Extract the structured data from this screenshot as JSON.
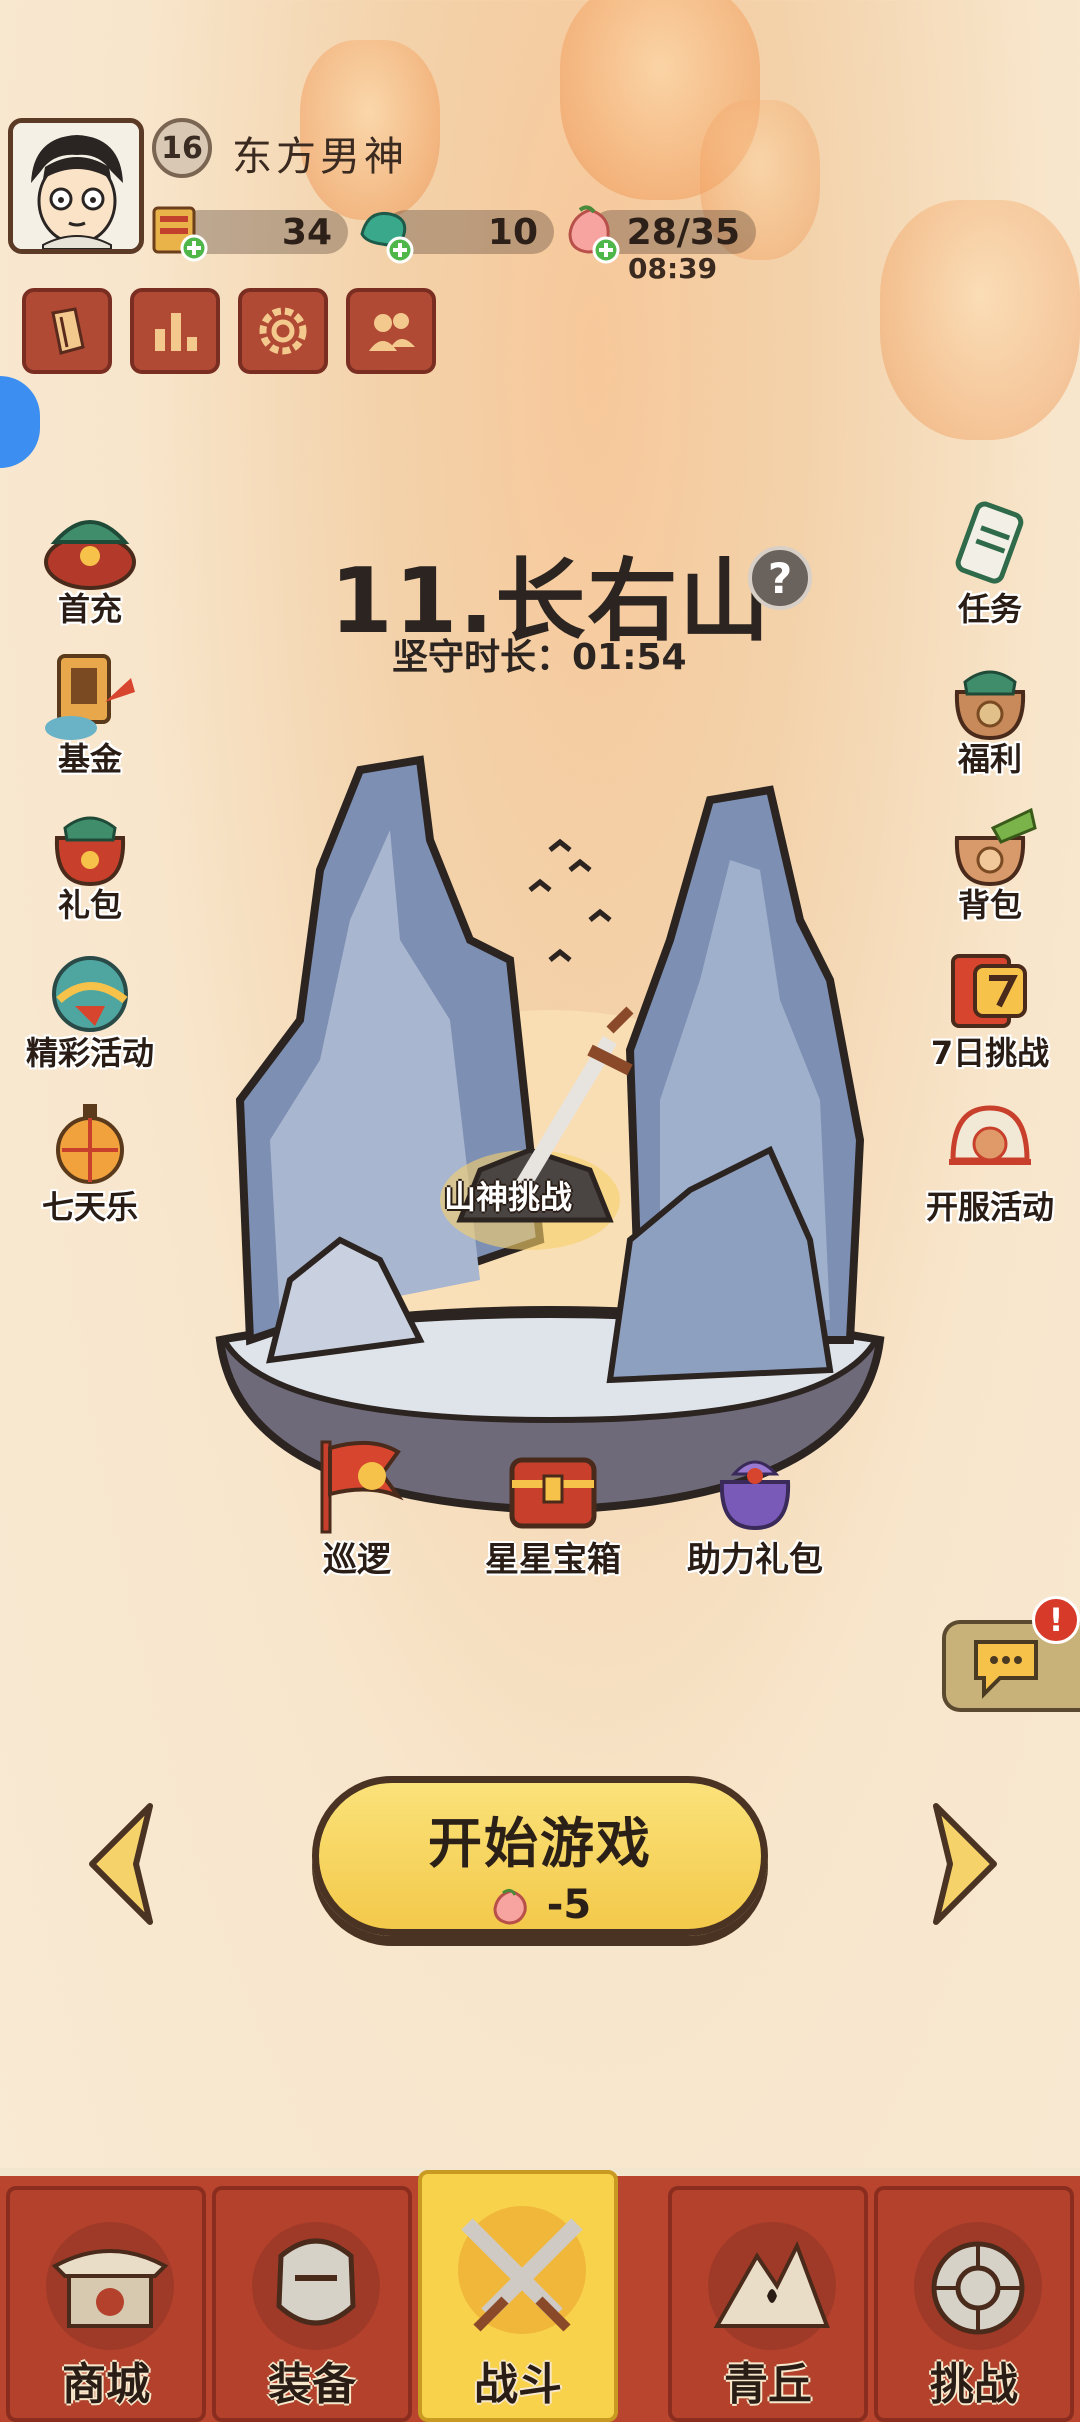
{
  "player": {
    "level": "16",
    "name": "东方男神"
  },
  "resources": [
    {
      "name": "scroll-icon",
      "value": "34"
    },
    {
      "name": "jade-icon",
      "value": "10"
    },
    {
      "name": "peach-icon",
      "value": "28/35",
      "timer": "08:39"
    }
  ],
  "system_buttons": [
    "ticket-icon",
    "ranking-icon",
    "settings-icon",
    "friends-icon"
  ],
  "left_menu": [
    {
      "label": "首充",
      "icon": "first-recharge-icon"
    },
    {
      "label": "基金",
      "icon": "fund-icon"
    },
    {
      "label": "礼包",
      "icon": "gift-bag-icon"
    },
    {
      "label": "精彩活动",
      "icon": "events-icon"
    },
    {
      "label": "七天乐",
      "icon": "seven-days-icon"
    }
  ],
  "right_menu": [
    {
      "label": "任务",
      "icon": "quest-icon"
    },
    {
      "label": "福利",
      "icon": "welfare-icon"
    },
    {
      "label": "背包",
      "icon": "backpack-icon"
    },
    {
      "label": "7日挑战",
      "icon": "seven-day-challenge-icon"
    },
    {
      "label": "开服活动",
      "icon": "server-launch-icon"
    }
  ],
  "stage": {
    "title": "11.长右山",
    "help": "?",
    "duration": "坚守时长：01:54",
    "challenge_label": "山神挑战"
  },
  "map_actions": [
    {
      "label": "巡逻",
      "icon": "patrol-flag-icon"
    },
    {
      "label": "星星宝箱",
      "icon": "star-chest-icon"
    },
    {
      "label": "助力礼包",
      "icon": "support-gift-icon"
    }
  ],
  "chat": {
    "alert": "!"
  },
  "start": {
    "label": "开始游戏",
    "cost": "-5"
  },
  "bottom_nav": [
    {
      "label": "商城",
      "icon": "shop-icon",
      "active": false
    },
    {
      "label": "装备",
      "icon": "equipment-icon",
      "active": false
    },
    {
      "label": "战斗",
      "icon": "battle-icon",
      "active": true
    },
    {
      "label": "青丘",
      "icon": "qingqiu-icon",
      "active": false
    },
    {
      "label": "挑战",
      "icon": "challenge-icon",
      "active": false
    }
  ],
  "colors": {
    "accent_yellow": "#f8d24a",
    "nav_red": "#b9452f",
    "text_dark": "#2b2420"
  }
}
